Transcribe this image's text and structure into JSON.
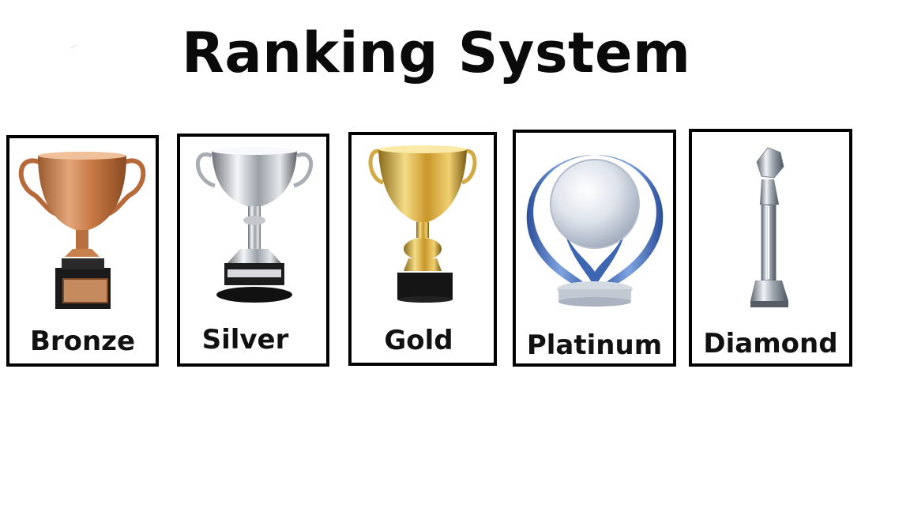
{
  "title": "Ranking System",
  "ranks": [
    {
      "name": "Bronze",
      "icon": "bronze-trophy-icon",
      "color": "#c8804e"
    },
    {
      "name": "Silver",
      "icon": "silver-trophy-icon",
      "color": "#b8bcc2"
    },
    {
      "name": "Gold",
      "icon": "gold-trophy-icon",
      "color": "#d9a92c"
    },
    {
      "name": "Platinum",
      "icon": "platinum-trophy-icon",
      "color": "#5a86c8"
    },
    {
      "name": "Diamond",
      "icon": "diamond-trophy-icon",
      "color": "#c9ced6"
    }
  ]
}
